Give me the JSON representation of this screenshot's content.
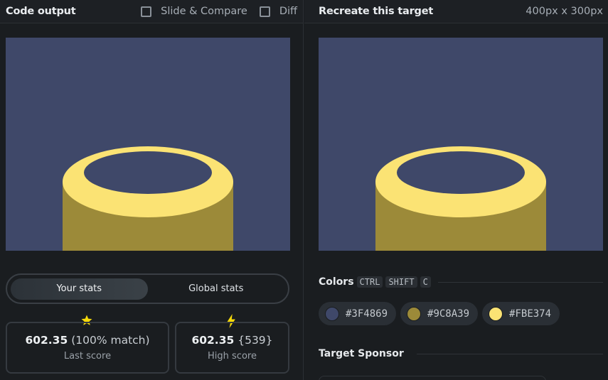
{
  "left_header": {
    "title": "Code output",
    "slide_compare_label": "Slide & Compare",
    "diff_label": "Diff"
  },
  "right_header": {
    "title": "Recreate this target",
    "dimensions": "400px x 300px"
  },
  "stats_toggle": {
    "your_stats": "Your stats",
    "global_stats": "Global stats"
  },
  "stats": {
    "last_score_value": "602.35",
    "last_score_match": "(100% match)",
    "last_score_label": "Last score",
    "high_score_value": "602.35",
    "high_score_chars": "{539}",
    "high_score_label": "High score"
  },
  "colors_section": {
    "label": "Colors",
    "shortcut_keys": [
      "CTRL",
      "SHIFT",
      "C"
    ],
    "swatches": [
      {
        "hex": "#3F4869",
        "color": "#3F4869"
      },
      {
        "hex": "#9C8A39",
        "color": "#9C8A39"
      },
      {
        "hex": "#FBE374",
        "color": "#FBE374"
      }
    ]
  },
  "sponsor_section": {
    "label": "Target Sponsor"
  },
  "icons": {
    "last_score": "star-icon",
    "high_score": "lightning-icon"
  }
}
